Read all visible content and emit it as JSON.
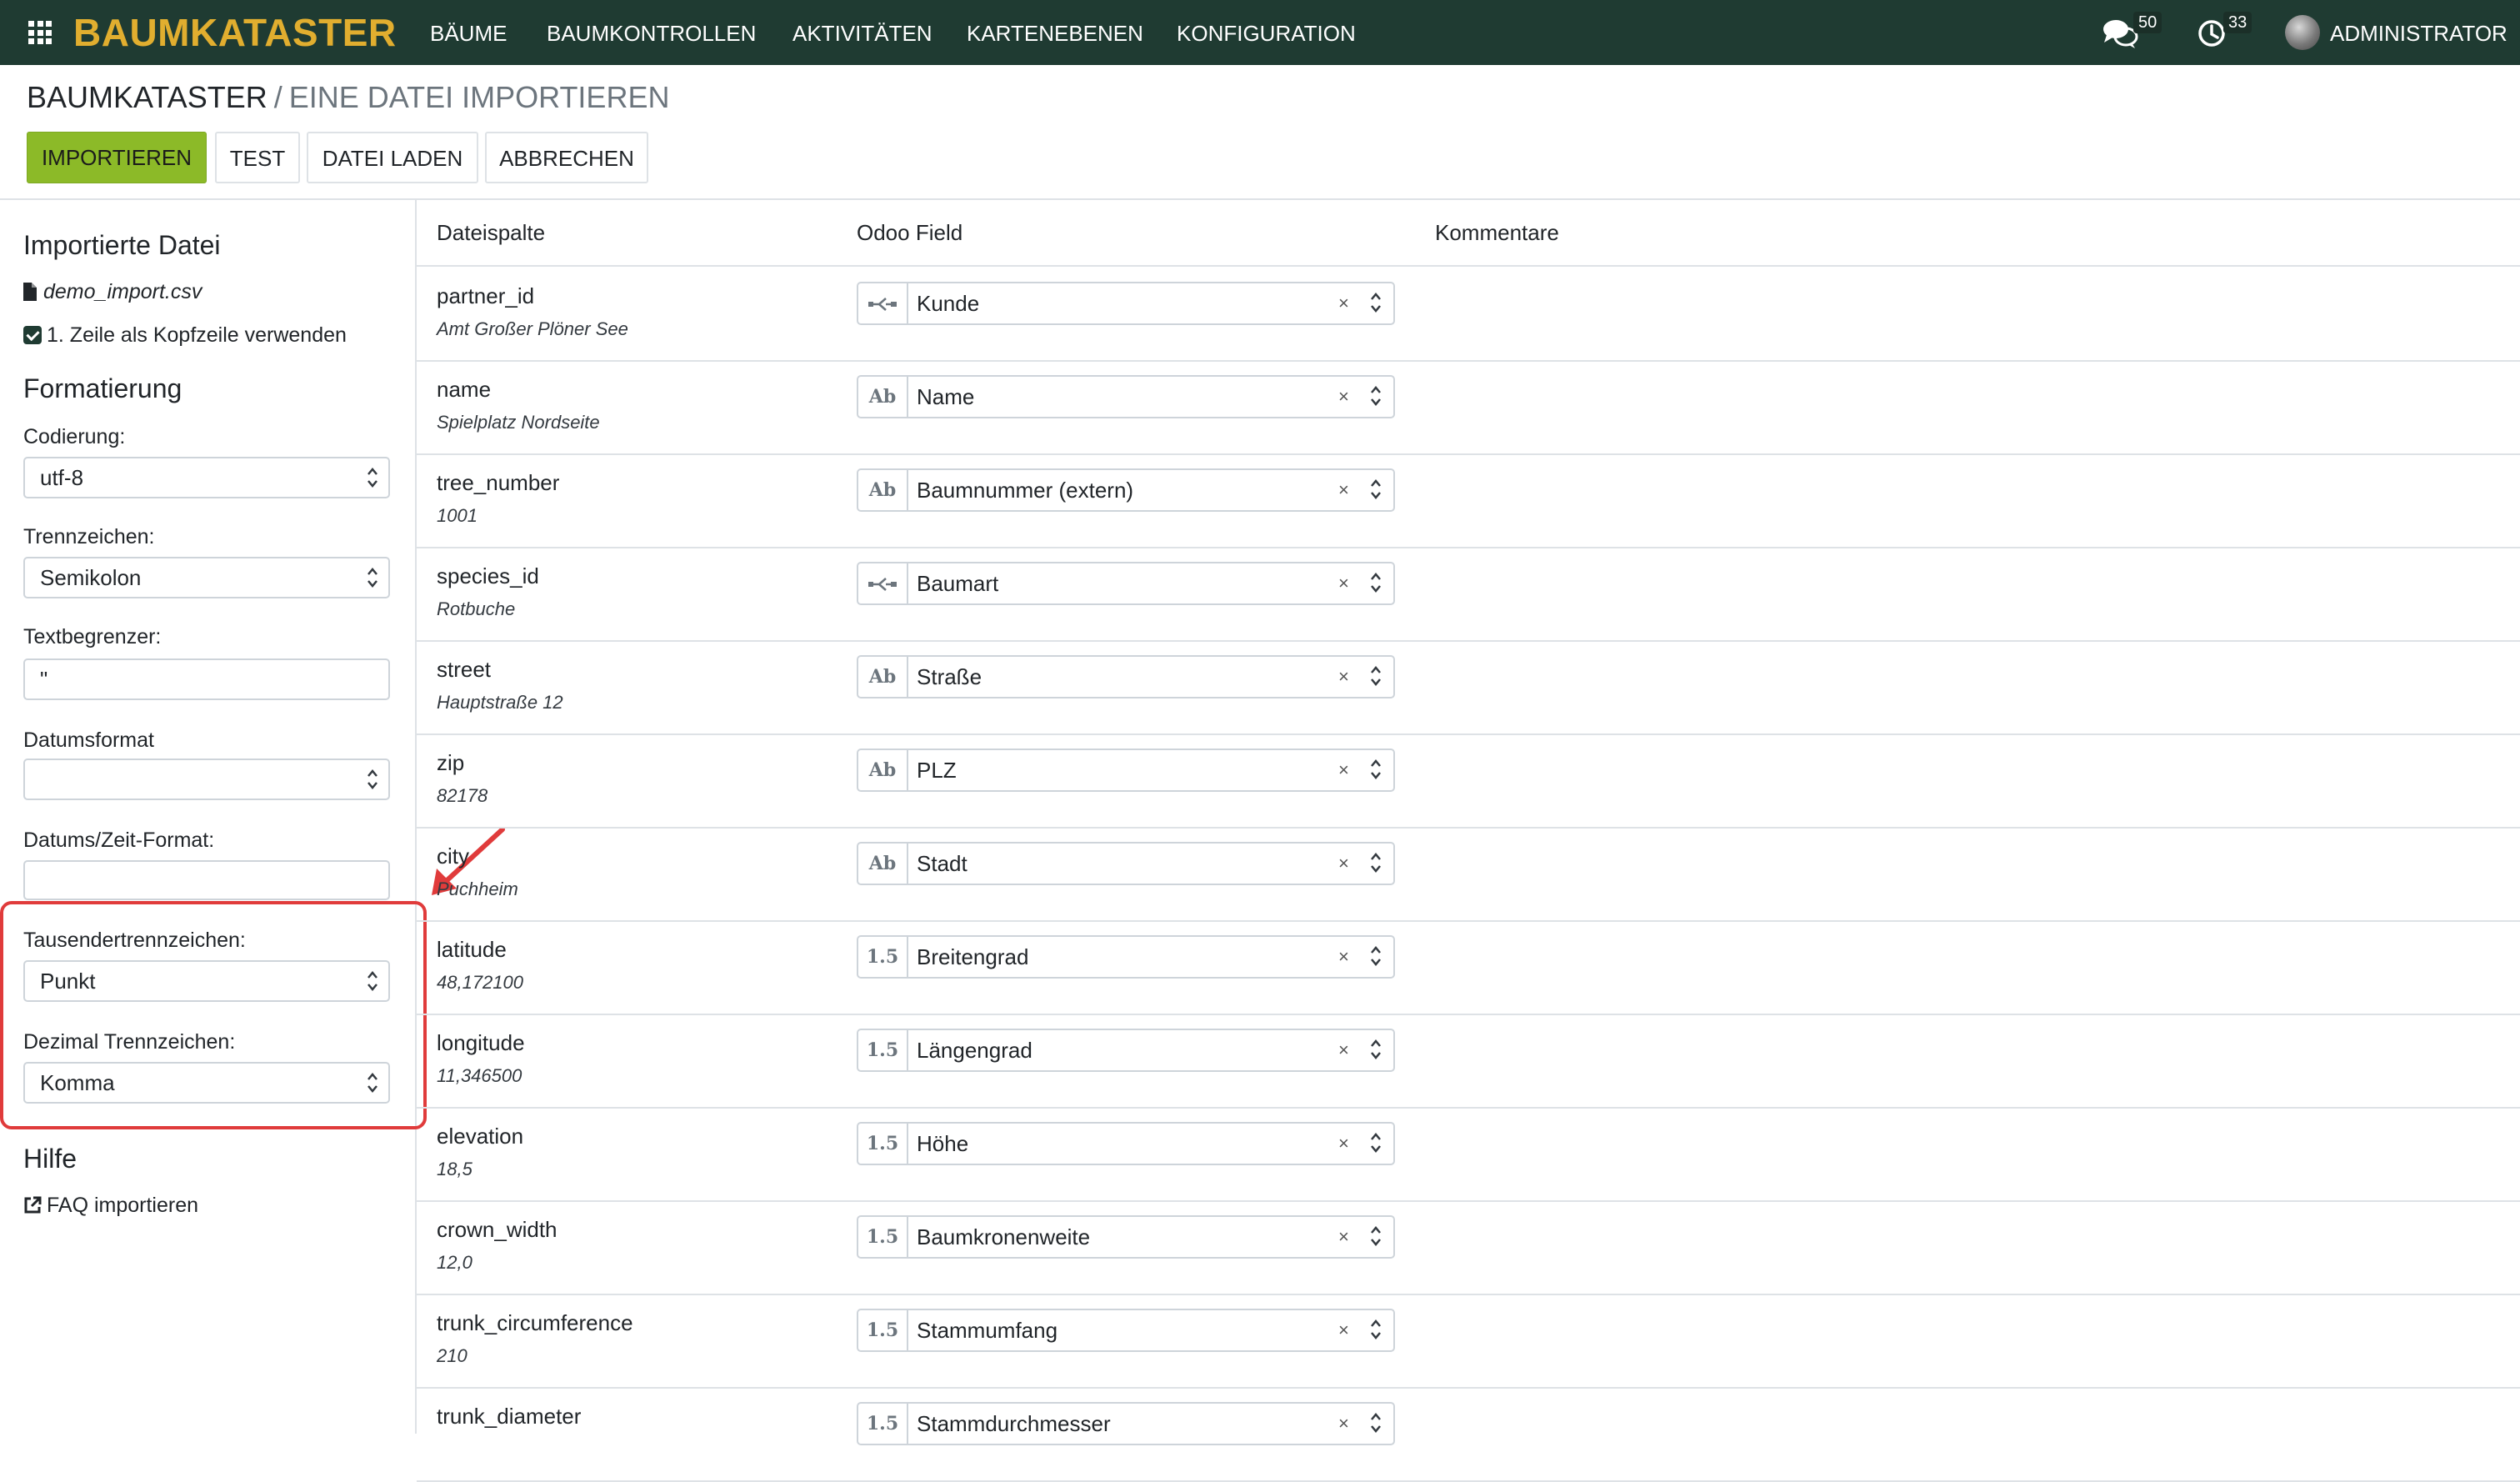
{
  "navbar": {
    "brand": "BAUMKATASTER",
    "menu": [
      "BÄUME",
      "BAUMKONTROLLEN",
      "AKTIVITÄTEN",
      "KARTENEBENEN",
      "KONFIGURATION"
    ],
    "messages_count": "50",
    "activities_count": "33",
    "user": "ADMINISTRATOR",
    "bg_color": "#1f3b32",
    "brand_color": "#e1ae2f"
  },
  "breadcrumb": {
    "root": "BAUMKATASTER",
    "separator": "/",
    "current": "EINE DATEI IMPORTIEREN"
  },
  "buttons": {
    "import": "IMPORTIEREN",
    "test": "TEST",
    "load_file": "DATEI LADEN",
    "cancel": "ABBRECHEN"
  },
  "sidebar": {
    "imported_file_title": "Importierte Datei",
    "file_name": "demo_import.csv",
    "header_option": "1. Zeile als Kopfzeile verwenden",
    "header_option_checked": true,
    "formatting_title": "Formatierung",
    "encoding_label": "Codierung:",
    "encoding_value": "utf-8",
    "separator_label": "Trennzeichen:",
    "separator_value": "Semikolon",
    "quote_label": "Textbegrenzer:",
    "quote_value": "\"",
    "date_format_label": "Datumsformat",
    "date_format_value": "",
    "datetime_format_label": "Datums/Zeit-Format:",
    "datetime_format_value": "",
    "thousands_label": "Tausendertrennzeichen:",
    "thousands_value": "Punkt",
    "decimal_label": "Dezimal Trennzeichen:",
    "decimal_value": "Komma",
    "help_title": "Hilfe",
    "faq_link": "FAQ importieren"
  },
  "table": {
    "headers": [
      "Dateispalte",
      "Odoo Field",
      "Kommentare"
    ],
    "rows": [
      {
        "column": "partner_id",
        "sample": "Amt Großer Plöner See",
        "type_icon": "relation-icon",
        "field": "Kunde"
      },
      {
        "column": "name",
        "sample": "Spielplatz Nordseite",
        "type_icon": "text-icon",
        "field": "Name"
      },
      {
        "column": "tree_number",
        "sample": "1001",
        "type_icon": "text-icon",
        "field": "Baumnummer (extern)"
      },
      {
        "column": "species_id",
        "sample": "Rotbuche",
        "type_icon": "relation-icon",
        "field": "Baumart"
      },
      {
        "column": "street",
        "sample": "Hauptstraße 12",
        "type_icon": "text-icon",
        "field": "Straße"
      },
      {
        "column": "zip",
        "sample": "82178",
        "type_icon": "text-icon",
        "field": "PLZ"
      },
      {
        "column": "city",
        "sample": "Puchheim",
        "type_icon": "text-icon",
        "field": "Stadt"
      },
      {
        "column": "latitude",
        "sample": "48,172100",
        "type_icon": "float-icon",
        "field": "Breitengrad"
      },
      {
        "column": "longitude",
        "sample": "11,346500",
        "type_icon": "float-icon",
        "field": "Längengrad"
      },
      {
        "column": "elevation",
        "sample": "18,5",
        "type_icon": "float-icon",
        "field": "Höhe"
      },
      {
        "column": "crown_width",
        "sample": "12,0",
        "type_icon": "float-icon",
        "field": "Baumkronenweite"
      },
      {
        "column": "trunk_circumference",
        "sample": "210",
        "type_icon": "float-icon",
        "field": "Stammumfang"
      },
      {
        "column": "trunk_diameter",
        "sample": "",
        "type_icon": "float-icon",
        "field": "Stammdurchmesser"
      }
    ],
    "icon_text": {
      "text-icon": "Ab",
      "float-icon": "1.5"
    },
    "clear_glyph": "×"
  },
  "annotation": {
    "color": "#e03b3b"
  }
}
